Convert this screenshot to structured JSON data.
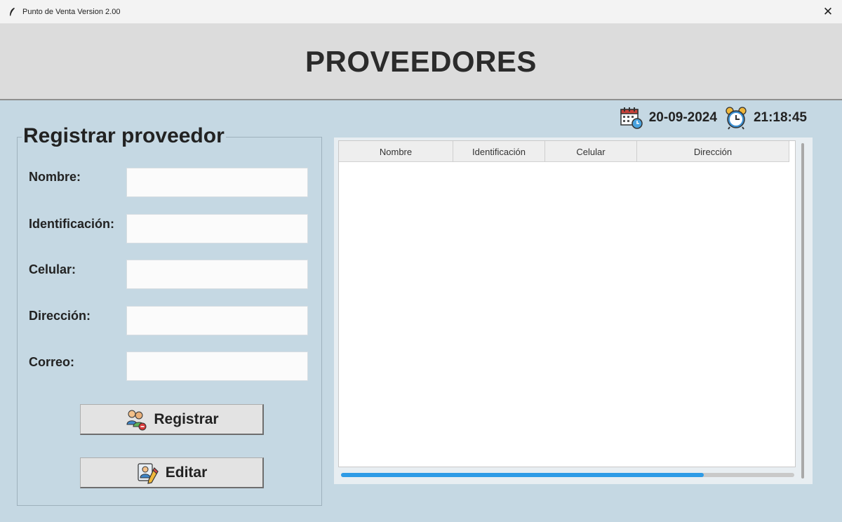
{
  "window": {
    "title": "Punto de Venta Version 2.00",
    "close_label": "✕"
  },
  "header": {
    "title": "PROVEEDORES"
  },
  "datetime": {
    "date": "20-09-2024",
    "time": "21:18:45",
    "date_icon": "calendar-clock-icon",
    "time_icon": "alarm-clock-icon"
  },
  "form": {
    "legend": "Registrar proveedor",
    "fields": [
      {
        "label": "Nombre:",
        "value": ""
      },
      {
        "label": "Identificación:",
        "value": ""
      },
      {
        "label": "Celular:",
        "value": ""
      },
      {
        "label": "Dirección:",
        "value": ""
      },
      {
        "label": "Correo:",
        "value": ""
      }
    ],
    "buttons": {
      "register": {
        "label": "Registrar",
        "icon": "add-users-icon"
      },
      "edit": {
        "label": "Editar",
        "icon": "edit-profile-icon"
      }
    }
  },
  "table": {
    "columns": [
      "Nombre",
      "Identificación",
      "Celular",
      "Dirección"
    ],
    "rows": [],
    "horizontal_scroll_fraction": 0.8
  },
  "colors": {
    "background": "#c5d8e3",
    "header": "#dcdcdc",
    "scroll_accent": "#2e9be6"
  }
}
